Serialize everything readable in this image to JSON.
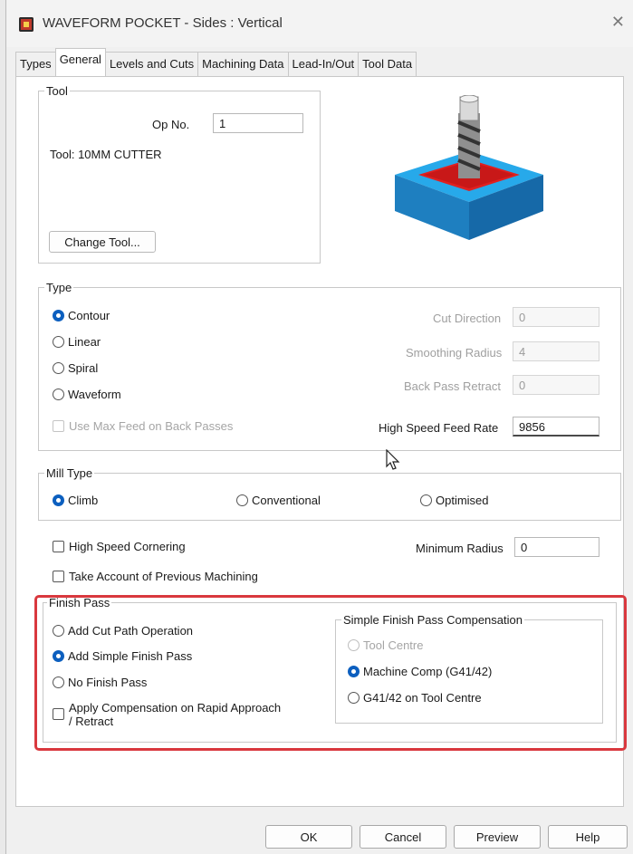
{
  "window": {
    "title": "WAVEFORM POCKET - Sides : Vertical",
    "close_glyph": "✕"
  },
  "tabs": [
    {
      "label": "Types"
    },
    {
      "label": "General"
    },
    {
      "label": "Levels and Cuts"
    },
    {
      "label": "Machining Data"
    },
    {
      "label": "Lead-In/Out"
    },
    {
      "label": "Tool Data"
    }
  ],
  "active_tab": "General",
  "tool": {
    "legend": "Tool",
    "op_label": "Op No.",
    "op_value": "1",
    "tool_text": "Tool: 10MM CUTTER",
    "change_button": "Change Tool...",
    "preview_icon": "pocket-tool-icon"
  },
  "type": {
    "legend": "Type",
    "options": [
      "Contour",
      "Linear",
      "Spiral",
      "Waveform"
    ],
    "selected": "Contour",
    "max_feed_label": "Use Max Feed on Back Passes",
    "cut_direction_label": "Cut Direction",
    "cut_direction_value": "0",
    "smoothing_radius_label": "Smoothing Radius",
    "smoothing_radius_value": "4",
    "back_pass_retract_label": "Back Pass Retract",
    "back_pass_retract_value": "0",
    "hs_feed_label": "High Speed Feed Rate",
    "hs_feed_value": "9856"
  },
  "mill_type": {
    "legend": "Mill Type",
    "options": [
      "Climb",
      "Conventional",
      "Optimised"
    ],
    "selected": "Climb"
  },
  "options": {
    "hs_cornering_label": "High Speed Cornering",
    "min_radius_label": "Minimum Radius",
    "min_radius_value": "0",
    "prev_machining_label": "Take Account of Previous Machining"
  },
  "finish_pass": {
    "legend": "Finish Pass",
    "options": [
      "Add Cut Path Operation",
      "Add Simple Finish Pass",
      "No Finish Pass"
    ],
    "selected": "Add Simple Finish Pass",
    "apply_comp_label_line1": "Apply Compensation on Rapid Approach",
    "apply_comp_label_line2": "/ Retract",
    "comp_legend": "Simple Finish Pass Compensation",
    "comp_options": [
      "Tool Centre",
      "Machine Comp (G41/42)",
      "G41/42 on Tool Centre"
    ],
    "comp_selected": "Machine Comp (G41/42)",
    "highlight_color": "#d9383e"
  },
  "buttons": {
    "ok": "OK",
    "cancel": "Cancel",
    "preview": "Preview",
    "help": "Help"
  },
  "colors": {
    "accent": "#0c5fbf",
    "block": "#1e8fd6",
    "pocket": "#e02020"
  }
}
